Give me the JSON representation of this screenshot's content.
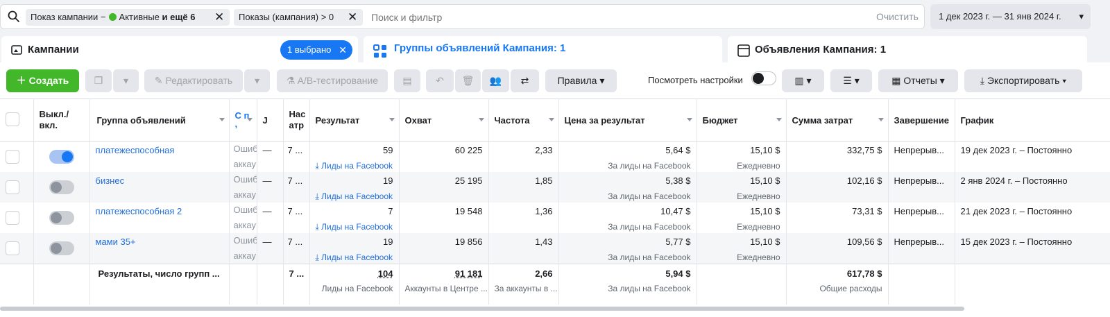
{
  "filter": {
    "chip1_prefix": "Показ кампании −",
    "chip1_active": "Активные",
    "chip1_more": "и ещё 6",
    "chip2": "Показы (кампания) > 0",
    "search_placeholder": "Поиск и фильтр",
    "clear": "Очистить",
    "date_range": "1 дек 2023 г. — 31 янв 2024 г."
  },
  "tabs": {
    "campaigns": "Кампании",
    "selected": "1 выбрано",
    "adsets": "Группы объявлений Кампания: 1",
    "ads": "Объявления Кампания: 1"
  },
  "toolbar": {
    "create": "Создать",
    "edit": "Редактировать",
    "ab": "A/B-тестирование",
    "rules": "Правила",
    "view_settings": "Посмотреть настройки",
    "reports": "Отчеты",
    "export": "Экспортировать"
  },
  "columns": {
    "onoff": "Выкл./ вкл.",
    "adset": "Группа объявлений",
    "delivery": "С п ,",
    "bid": "Ј",
    "attribution": "Нас атр",
    "result": "Результат",
    "reach": "Охват",
    "frequency": "Частота",
    "cpr": "Цена за результат",
    "budget": "Бюджет",
    "spend": "Сумма затрат",
    "ends": "Завершение",
    "schedule": "График"
  },
  "rows": [
    {
      "name": "платежеспособная",
      "on": true,
      "delivery1": "Ошиб",
      "delivery2": "аккау",
      "bid": "—",
      "attr": "7 ...",
      "result": "59",
      "result_sub": "Лиды на Facebook",
      "reach": "60 225",
      "freq": "2,33",
      "cpr": "5,64 $",
      "cpr_sub": "За лиды на Facebook",
      "budget": "15,10 $",
      "budget_sub": "Ежедневно",
      "spend": "332,75 $",
      "ends": "Непрерыв...",
      "schedule": "19 дек 2023 г. – Постоянно"
    },
    {
      "name": "бизнес",
      "on": false,
      "delivery1": "Ошиб",
      "delivery2": "аккау",
      "bid": "—",
      "attr": "7 ...",
      "result": "19",
      "result_sub": "Лиды на Facebook",
      "reach": "25 195",
      "freq": "1,85",
      "cpr": "5,38 $",
      "cpr_sub": "За лиды на Facebook",
      "budget": "15,10 $",
      "budget_sub": "Ежедневно",
      "spend": "102,16 $",
      "ends": "Непрерыв...",
      "schedule": "2 янв 2024 г. – Постоянно"
    },
    {
      "name": "платежеспособная 2",
      "on": false,
      "delivery1": "Ошиб",
      "delivery2": "аккау",
      "bid": "—",
      "attr": "7 ...",
      "result": "7",
      "result_sub": "Лиды на Facebook",
      "reach": "19 548",
      "freq": "1,36",
      "cpr": "10,47 $",
      "cpr_sub": "За лиды на Facebook",
      "budget": "15,10 $",
      "budget_sub": "Ежедневно",
      "spend": "73,31 $",
      "ends": "Непрерыв...",
      "schedule": "21 дек 2023 г. – Постоянно"
    },
    {
      "name": "мами 35+",
      "on": false,
      "delivery1": "Ошиб",
      "delivery2": "аккау",
      "bid": "—",
      "attr": "7 ...",
      "result": "19",
      "result_sub": "Лиды на Facebook",
      "reach": "19 856",
      "freq": "1,43",
      "cpr": "5,77 $",
      "cpr_sub": "За лиды на Facebook",
      "budget": "15,10 $",
      "budget_sub": "Ежедневно",
      "spend": "109,56 $",
      "ends": "Непрерыв...",
      "schedule": "15 дек 2023 г. – Постоянно"
    }
  ],
  "totals": {
    "label": "Результаты, число групп ...",
    "attr": "7 ...",
    "result": "104",
    "result_sub": "Лиды на Facebook",
    "reach": "91 181",
    "reach_sub": "Аккаунты в Центре ...",
    "freq": "2,66",
    "freq_sub": "За аккаунты в ...",
    "cpr": "5,94 $",
    "cpr_sub": "За лиды на Facebook",
    "spend": "617,78 $",
    "spend_sub": "Общие расходы"
  },
  "colors": {
    "accent": "#1877f2",
    "create_green": "#42b72a",
    "link": "#216fdb"
  }
}
